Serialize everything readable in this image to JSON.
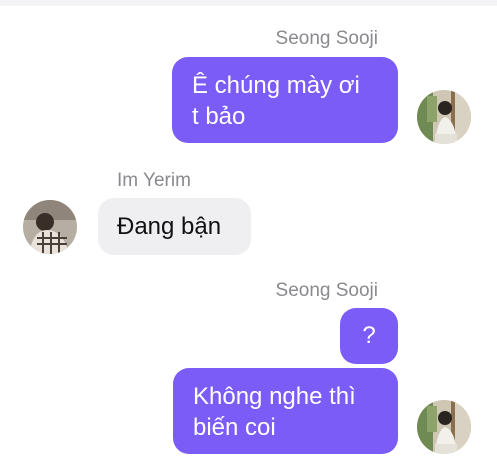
{
  "chat": {
    "groups": [
      {
        "sender": "Seong Sooji",
        "messages": [
          {
            "lines": [
              "Ê chúng mày ơi",
              "t bảo"
            ]
          }
        ]
      },
      {
        "sender": "Im Yerim",
        "messages": [
          {
            "lines": [
              "Đang bận"
            ]
          }
        ]
      },
      {
        "sender": "Seong Sooji",
        "messages": [
          {
            "lines": [
              "?"
            ]
          },
          {
            "lines": [
              "Không nghe thì",
              "biến coi"
            ]
          }
        ]
      }
    ]
  },
  "colors": {
    "outgoing_bubble": "#7c5cf6",
    "incoming_bubble": "#efeff2",
    "sender_name": "#8a8a8e"
  },
  "icons": {
    "sooji_avatar": "profile-photo-avatar",
    "yerim_avatar": "profile-photo-avatar"
  }
}
